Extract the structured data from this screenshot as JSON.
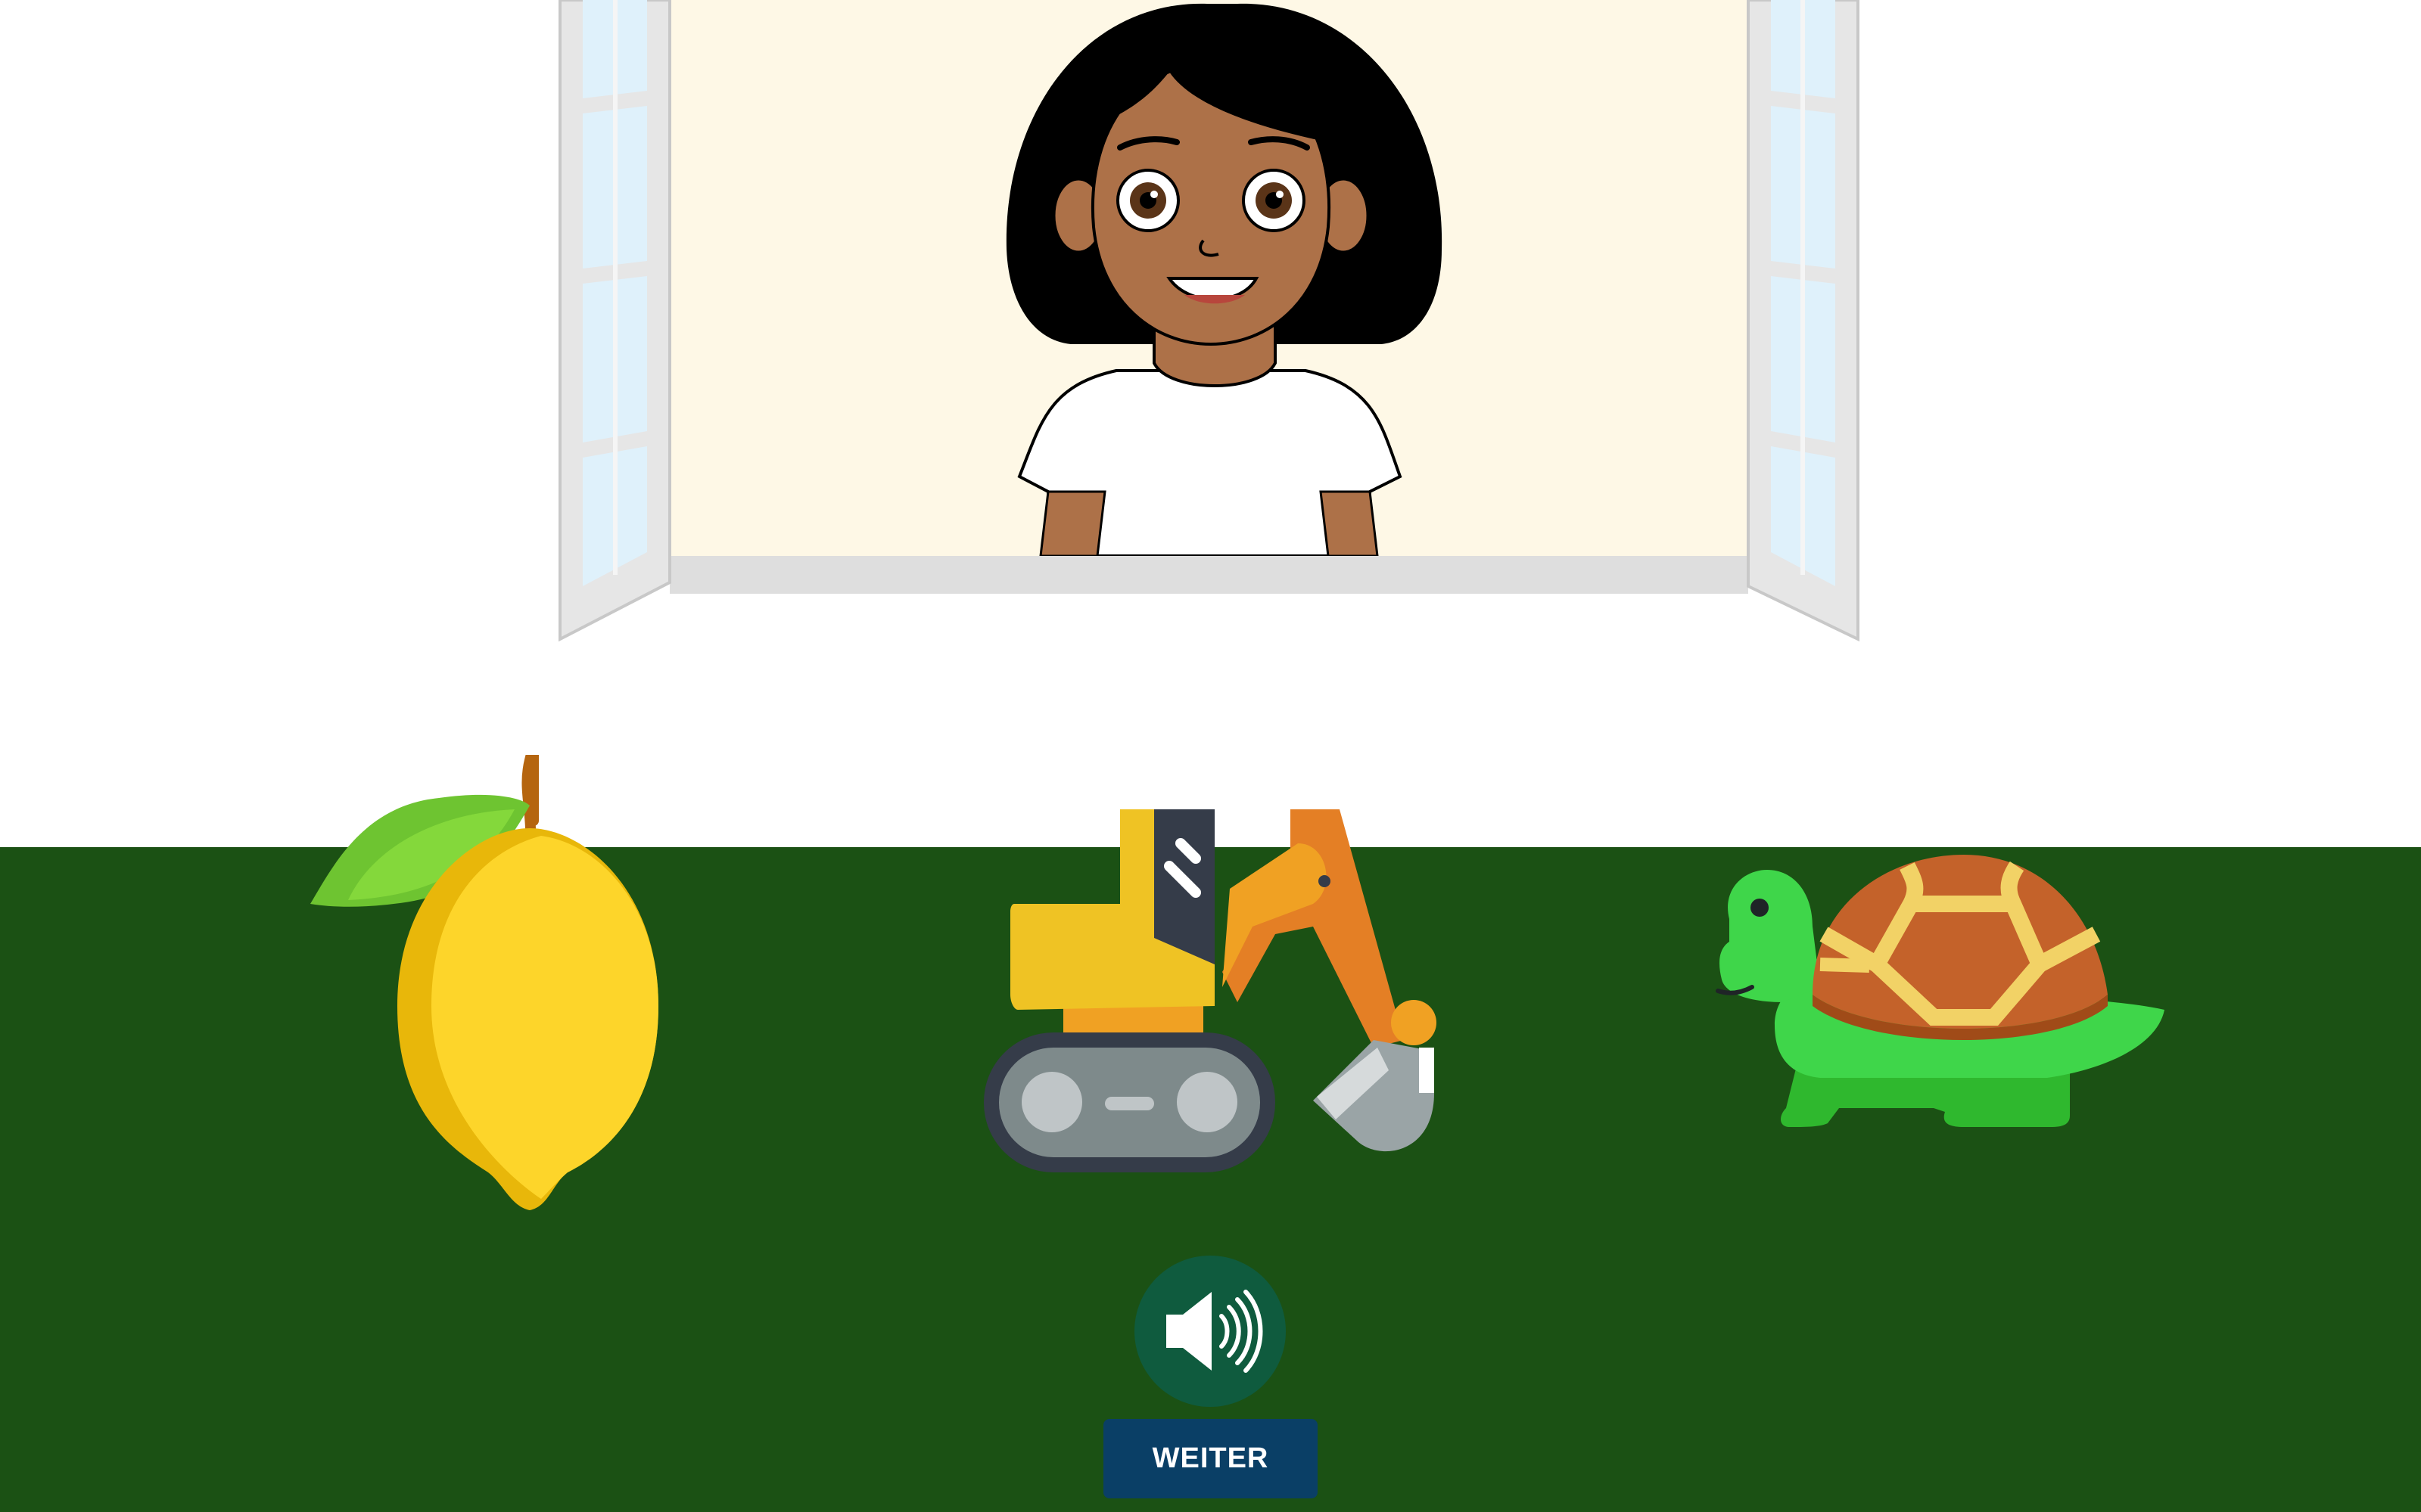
{
  "scene": {
    "wall_color": "#ffffff",
    "floor_color": "#1b5114",
    "window_interior_color": "#fef8e6",
    "objects": [
      {
        "name": "lemon",
        "icon": "lemon-icon"
      },
      {
        "name": "excavator",
        "icon": "excavator-icon"
      },
      {
        "name": "turtle",
        "icon": "turtle-icon"
      }
    ],
    "character": {
      "icon": "girl-character"
    }
  },
  "controls": {
    "sound_icon": "speaker-icon",
    "sound_button_color": "#0f5b3e",
    "continue_label": "WEITER",
    "continue_button_color": "#0a3f66"
  }
}
